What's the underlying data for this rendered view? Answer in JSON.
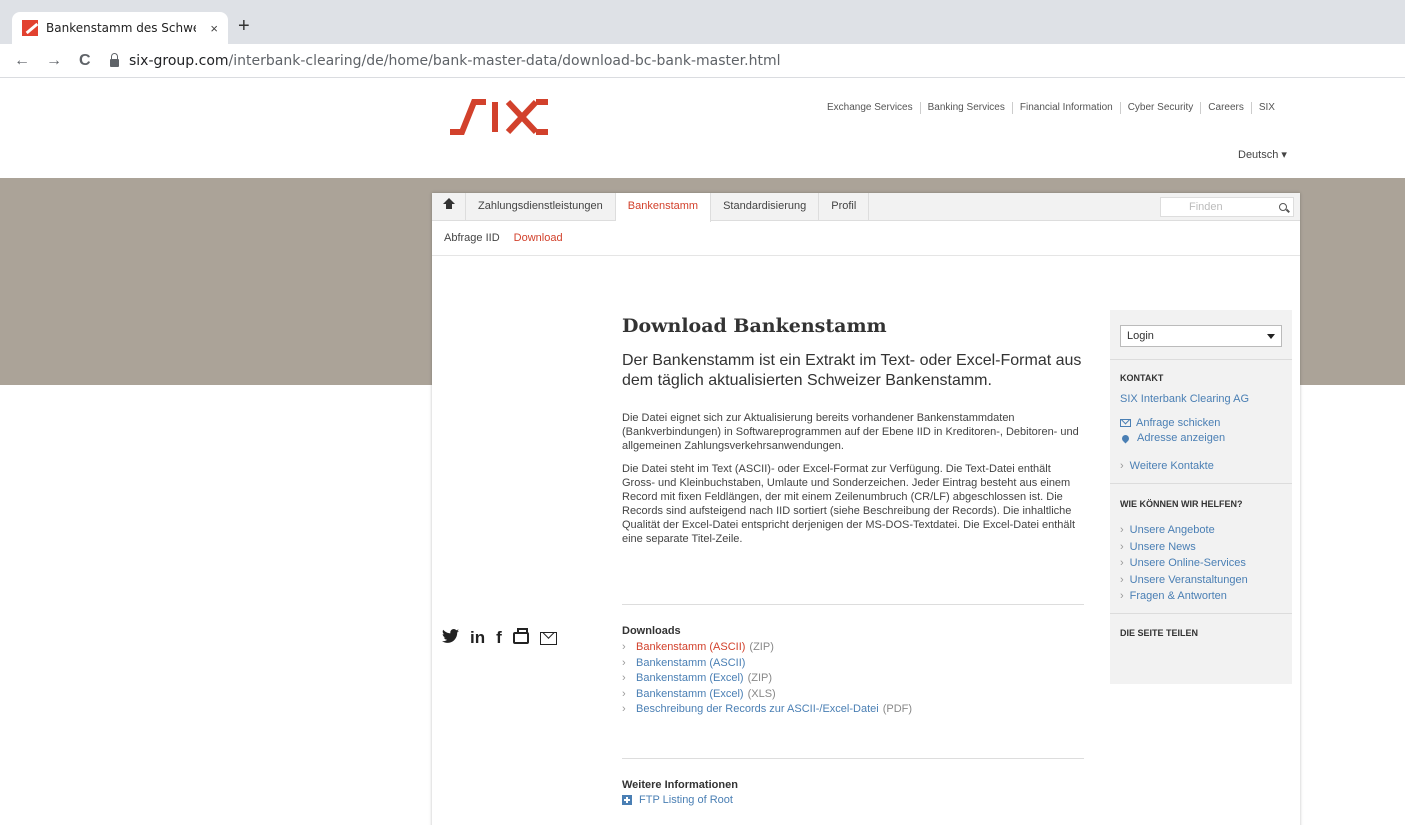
{
  "browser": {
    "tab_title": "Bankenstamm des Schweizer Zah",
    "tab_close": "×",
    "new_tab": "+",
    "back": "←",
    "forward": "→",
    "reload": "C",
    "url_host": "six-group.com",
    "url_path": "/interbank-clearing/de/home/bank-master-data/download-bc-bank-master.html"
  },
  "header": {
    "topnav": [
      "Exchange Services",
      "Banking Services",
      "Financial Information",
      "Cyber Security",
      "Careers",
      "SIX"
    ],
    "language": "Deutsch ▾",
    "brand_color": "#d2412c"
  },
  "mainnav": {
    "items": [
      "Zahlungsdienstleistungen",
      "Bankenstamm",
      "Standardisierung",
      "Profil"
    ],
    "search_placeholder": "Finden"
  },
  "subnav": {
    "items": [
      "Abfrage IID",
      "Download"
    ]
  },
  "article": {
    "title": "Download Bankenstamm",
    "lead": "Der Bankenstamm ist ein Extrakt im Text- oder Excel-Format aus dem täglich aktualisierten Schweizer Bankenstamm.",
    "para1": "Die Datei eignet sich zur Aktualisierung bereits vorhandener Bankenstammdaten (Bankverbindungen) in Softwareprogrammen auf der Ebene IID in Kreditoren-, Debitoren- und allgemeinen Zahlungsverkehrsanwendungen.",
    "para2": "Die Datei steht im Text (ASCII)- oder Excel-Format zur Verfügung. Die Text-Datei enthält Gross- und Kleinbuchstaben, Umlaute und Sonderzeichen. Jeder Eintrag besteht aus einem Record mit fixen Feldlängen, der mit einem Zeilenumbruch (CR/LF) abgeschlossen ist. Die Records sind aufsteigend nach IID sortiert (siehe Beschreibung der Records). Die inhaltliche Qualität der Excel-Datei entspricht derjenigen der MS-DOS-Textdatei. Die Excel-Datei enthält eine separate Titel-Zeile."
  },
  "downloads": {
    "title": "Downloads",
    "items": [
      {
        "label": "Bankenstamm (ASCII)",
        "suffix": "(ZIP)"
      },
      {
        "label": "Bankenstamm (ASCII)",
        "suffix": ""
      },
      {
        "label": "Bankenstamm (Excel)",
        "suffix": "(ZIP)"
      },
      {
        "label": "Bankenstamm (Excel)",
        "suffix": "(XLS)"
      },
      {
        "label": "Beschreibung der Records zur ASCII-/Excel-Datei",
        "suffix": "(PDF)"
      }
    ]
  },
  "more_info": {
    "title": "Weitere Informationen",
    "link": "FTP Listing of Root"
  },
  "sidebar": {
    "login": "Login",
    "contact_head": "KONTAKT",
    "company": "SIX Interbank Clearing AG",
    "inquiry": "Anfrage schicken",
    "address": "Adresse anzeigen",
    "more_contacts": "Weitere Kontakte",
    "help_head": "WIE KÖNNEN WIR HELFEN?",
    "help_items": [
      "Unsere Angebote",
      "Unsere News",
      "Unsere Online-Services",
      "Unsere Veranstaltungen",
      "Fragen & Antworten"
    ],
    "share_head": "DIE SEITE TEILEN",
    "share_twitter": "🐦",
    "share_linkedin": "in",
    "share_facebook": "f"
  }
}
